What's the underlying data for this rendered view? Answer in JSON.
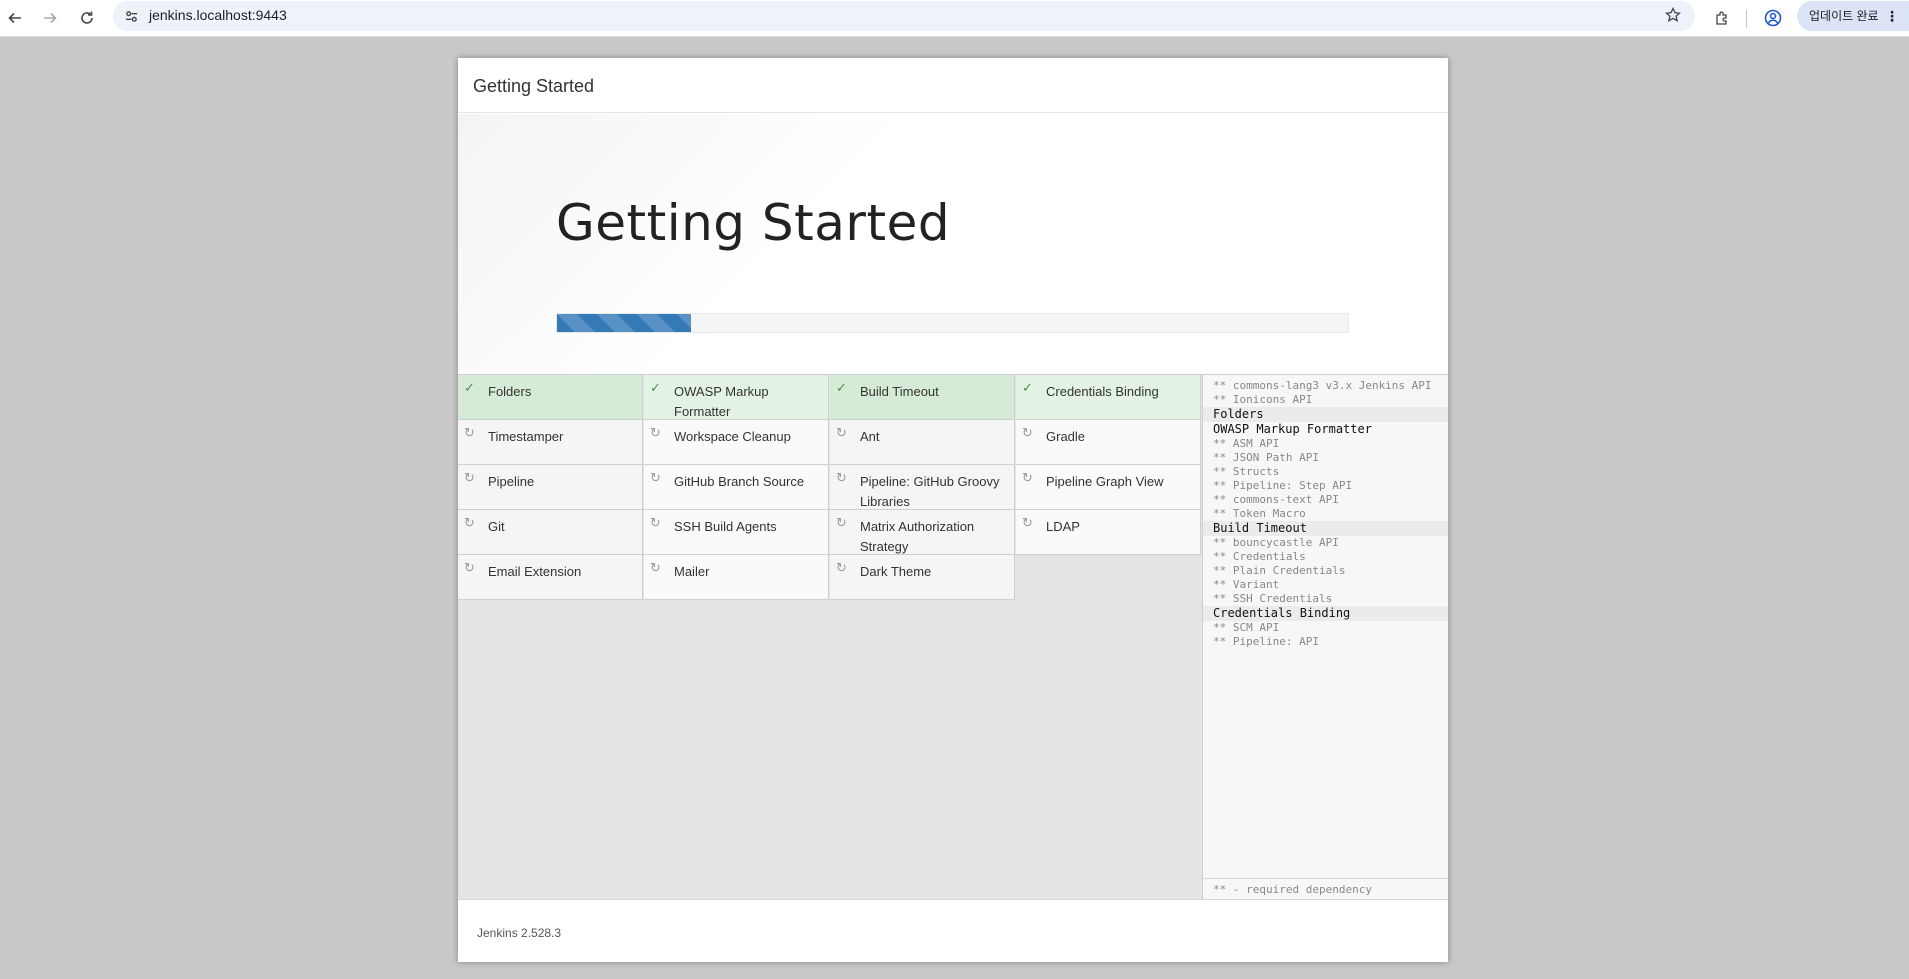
{
  "browser": {
    "url": "jenkins.localhost:9443",
    "update_label": "업데이트 완료",
    "icons": [
      "back-arrow-icon",
      "forward-arrow-icon",
      "reload-icon",
      "site-info-icon",
      "star-icon",
      "extensions-icon",
      "profile-icon",
      "more-icon"
    ]
  },
  "dialog": {
    "header_title": "Getting Started",
    "hero_title": "Getting Started",
    "progress_fraction": 0.17,
    "colors": {
      "progress": "#337ab7",
      "installed": "#d6ebd6",
      "pending": "#f5f5f5"
    }
  },
  "plugins": [
    {
      "name": "Folders",
      "status": "installed"
    },
    {
      "name": "OWASP Markup Formatter",
      "status": "installed"
    },
    {
      "name": "Build Timeout",
      "status": "installed"
    },
    {
      "name": "Credentials Binding",
      "status": "installed"
    },
    {
      "name": "Timestamper",
      "status": "pending"
    },
    {
      "name": "Workspace Cleanup",
      "status": "pending"
    },
    {
      "name": "Ant",
      "status": "pending"
    },
    {
      "name": "Gradle",
      "status": "pending"
    },
    {
      "name": "Pipeline",
      "status": "pending"
    },
    {
      "name": "GitHub Branch Source",
      "status": "pending"
    },
    {
      "name": "Pipeline: GitHub Groovy Libraries",
      "status": "pending"
    },
    {
      "name": "Pipeline Graph View",
      "status": "pending"
    },
    {
      "name": "Git",
      "status": "pending"
    },
    {
      "name": "SSH Build Agents",
      "status": "pending"
    },
    {
      "name": "Matrix Authorization Strategy",
      "status": "pending"
    },
    {
      "name": "LDAP",
      "status": "pending"
    },
    {
      "name": "Email Extension",
      "status": "pending"
    },
    {
      "name": "Mailer",
      "status": "pending"
    },
    {
      "name": "Dark Theme",
      "status": "pending"
    }
  ],
  "log": [
    {
      "text": "** commons-lang3 v3.x Jenkins API",
      "kind": "dep"
    },
    {
      "text": "** Ionicons API",
      "kind": "dep"
    },
    {
      "text": "Folders",
      "kind": "head"
    },
    {
      "text": "OWASP Markup Formatter",
      "kind": "head-plain"
    },
    {
      "text": "** ASM API",
      "kind": "dep"
    },
    {
      "text": "** JSON Path API",
      "kind": "dep"
    },
    {
      "text": "** Structs",
      "kind": "dep"
    },
    {
      "text": "** Pipeline: Step API",
      "kind": "dep"
    },
    {
      "text": "** commons-text API",
      "kind": "dep"
    },
    {
      "text": "** Token Macro",
      "kind": "dep"
    },
    {
      "text": "Build Timeout",
      "kind": "head"
    },
    {
      "text": "** bouncycastle API",
      "kind": "dep"
    },
    {
      "text": "** Credentials",
      "kind": "dep"
    },
    {
      "text": "** Plain Credentials",
      "kind": "dep"
    },
    {
      "text": "** Variant",
      "kind": "dep"
    },
    {
      "text": "** SSH Credentials",
      "kind": "dep"
    },
    {
      "text": "Credentials Binding",
      "kind": "head"
    },
    {
      "text": "** SCM API",
      "kind": "dep"
    },
    {
      "text": "** Pipeline: API",
      "kind": "dep"
    }
  ],
  "log_footer": "** - required dependency",
  "footer": {
    "version": "Jenkins 2.528.3"
  }
}
